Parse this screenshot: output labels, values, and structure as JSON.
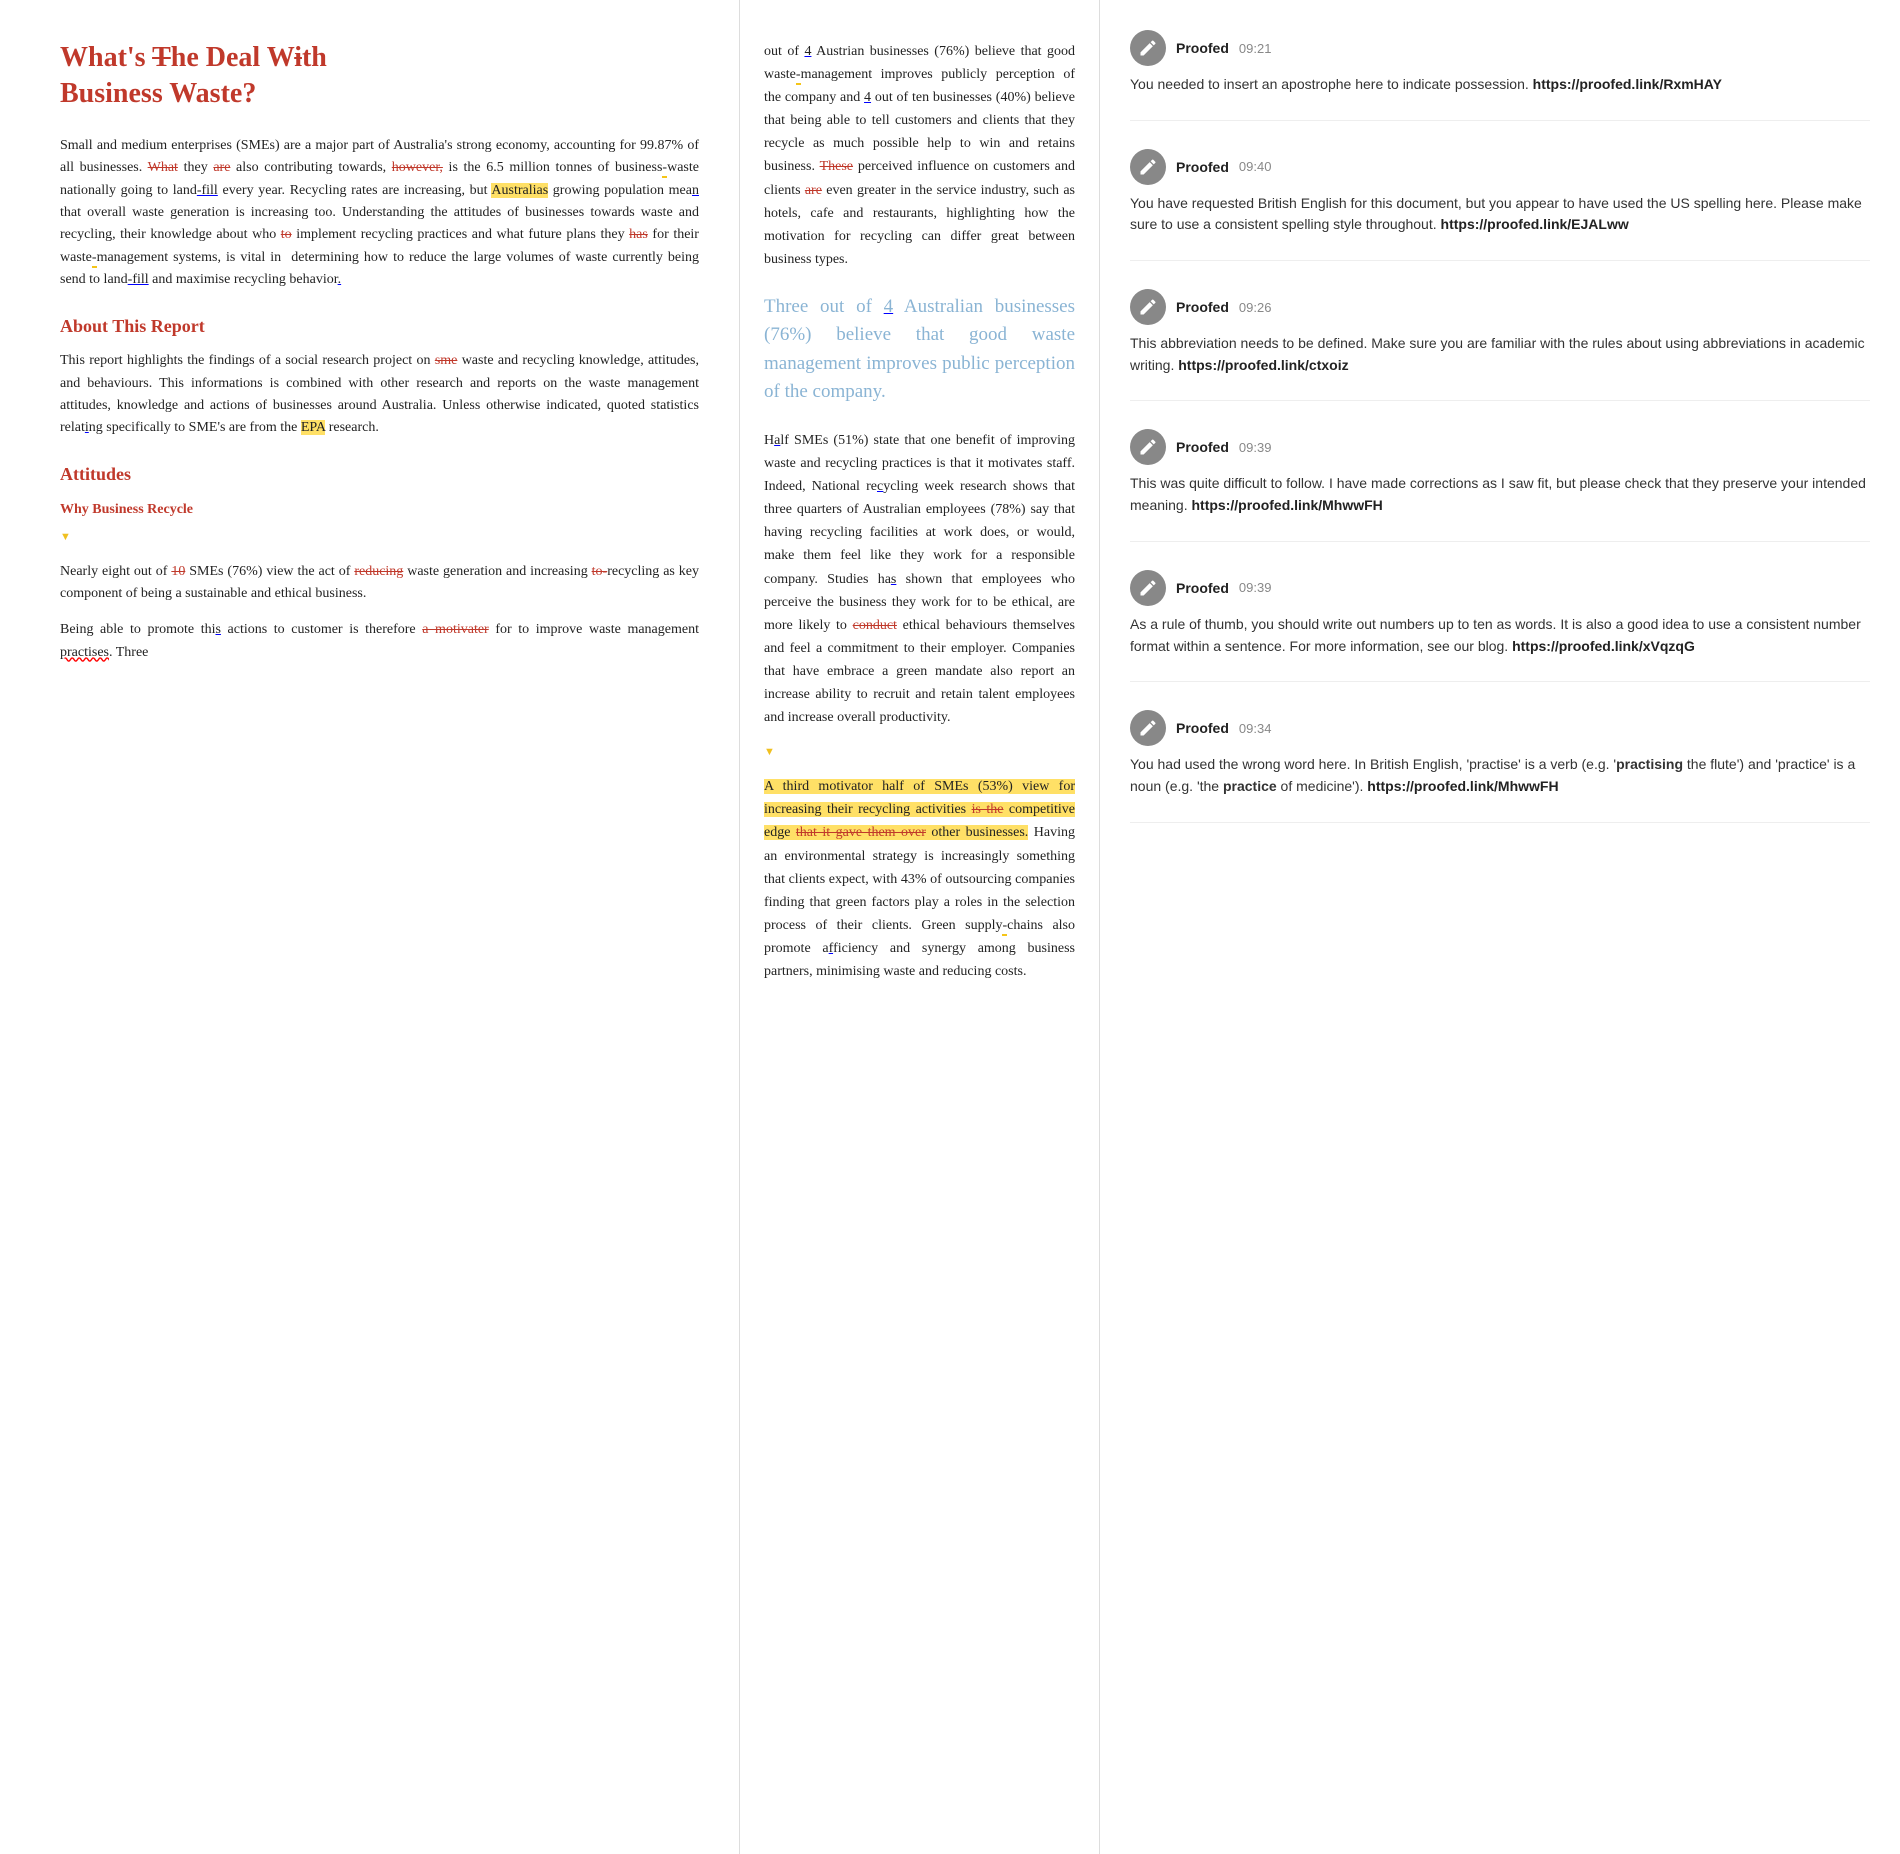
{
  "document": {
    "title": "What's The Deal With Business Waste?",
    "sections": [
      {
        "type": "paragraph",
        "id": "intro",
        "text": "Small and medium enterprises (SMEs) are a major part of Australia's strong economy, accounting for 99.87% of all businesses. What they are also contributing towards, however, is the 6.5 million tonnes of business waste nationally going to landfill every year. Recycling rates are increasing, but Australias growing population mean that overall waste generation is increasing too. Understanding the attitudes of businesses towards waste and recycling, their knowledge about who to implement recycling practices and what future plans they has for their waste management systems, is vital in determining how to reduce the large volumes of waste currently being send to landfill and maximise recycling behavior."
      },
      {
        "type": "heading",
        "id": "about-heading",
        "text": "About This Report"
      },
      {
        "type": "paragraph",
        "id": "about-para",
        "text": "This report highlights the findings of a social research project on sme waste and recycling knowledge, attitudes, and behaviours. This informations is combined with other research and reports on the waste management attitudes, knowledge and actions of businesses around Australia. Unless otherwise indicated, quoted statistics relating specifically to SME's are from the EPA research."
      },
      {
        "type": "heading",
        "id": "attitudes-heading",
        "text": "Attitudes"
      },
      {
        "type": "subheading",
        "id": "why-recycle-heading",
        "text": "Why Business Recycle"
      },
      {
        "type": "paragraph",
        "id": "why-recycle-para",
        "text": "Nearly eight out of 10 SMEs (76%) view the act of reducing waste generation and increasing to recycling as key component of being a sustainable and ethical business."
      },
      {
        "type": "paragraph",
        "id": "promote-para",
        "text": "Being able to promote this actions to customer is therefore a motivater for to improve waste management practises. Three"
      }
    ]
  },
  "center": {
    "continuation": "out of 4 Austrian businesses (76%) believe that good waste management improves publicly perception of the company and 4 out of ten businesses (40%) believe that being able to tell customers and clients that they recycle as much possible help to win and retains business. These perceived influence on customers and clients are even greater in the service industry, such as hotels, cafe and restaurants, highlighting how the motivation for recycling can differ great between business types.",
    "pullquote": "Three out of 4 Australian businesses (76%) believe that good waste management improves public perception of the company.",
    "second_para": "Half SMEs (51%) state that one benefit of improving waste and recycling practices is that it motivates staff. Indeed, National recycling week research shows that three quarters of Australian employees (78%) say that having recycling facilities at work does, or would, make them feel like they work for a responsible company. Studies has shown that employees who perceive the business they work for to be ethical, are more likely to conduct ethical behaviours themselves and feel a commitment to their employer. Companies that have embrace a green mandate also report an increase ability to recruit and retain talent employees and increase overall productivity.",
    "third_para": "A third motivator half of SMEs (53%) view for increasing their recycling activities is the competitive edge that it gave them over other businesses. Having an environmental strategy is increasingly something that clients expect, with 43% of outsourcing companies finding that green factors play a roles in the selection process of their clients. Green supply chains also promote afficiency and synergy among business partners, minimising waste and reducing costs."
  },
  "comments": [
    {
      "id": "c1",
      "author": "Proofed",
      "time": "09:21",
      "body": "You needed to insert an apostrophe here to indicate possession.",
      "link": "https://proofed.link/RxmHAY"
    },
    {
      "id": "c2",
      "author": "Proofed",
      "time": "09:40",
      "body": "You have requested British English for this document, but you appear to have used the US spelling here. Please make sure to use a consistent spelling style throughout.",
      "link": "https://proofed.link/EJALww"
    },
    {
      "id": "c3",
      "author": "Proofed",
      "time": "09:26",
      "body": "This abbreviation needs to be defined. Make sure you are familiar with the rules about using abbreviations in academic writing.",
      "link": "https://proofed.link/ctxoiz"
    },
    {
      "id": "c4",
      "author": "Proofed",
      "time": "09:39",
      "body": "This was quite difficult to follow. I have made corrections as I saw fit, but please check that they preserve your intended meaning.",
      "link": "https://proofed.link/MhwwFH"
    },
    {
      "id": "c5",
      "author": "Proofed",
      "time": "09:39",
      "body": "As a rule of thumb, you should write out numbers up to ten as words. It is also a good idea to use a consistent number format within a sentence. For more information, see our blog.",
      "link": "https://proofed.link/xVqzqG"
    },
    {
      "id": "c6",
      "author": "Proofed",
      "time": "09:34",
      "body": "You had used the wrong word here. In British English, 'practise' is a verb (e.g. 'practising the flute') and 'practice' is a noun (e.g. 'the practice of medicine').",
      "link": "https://proofed.link/MhwwFH"
    }
  ]
}
